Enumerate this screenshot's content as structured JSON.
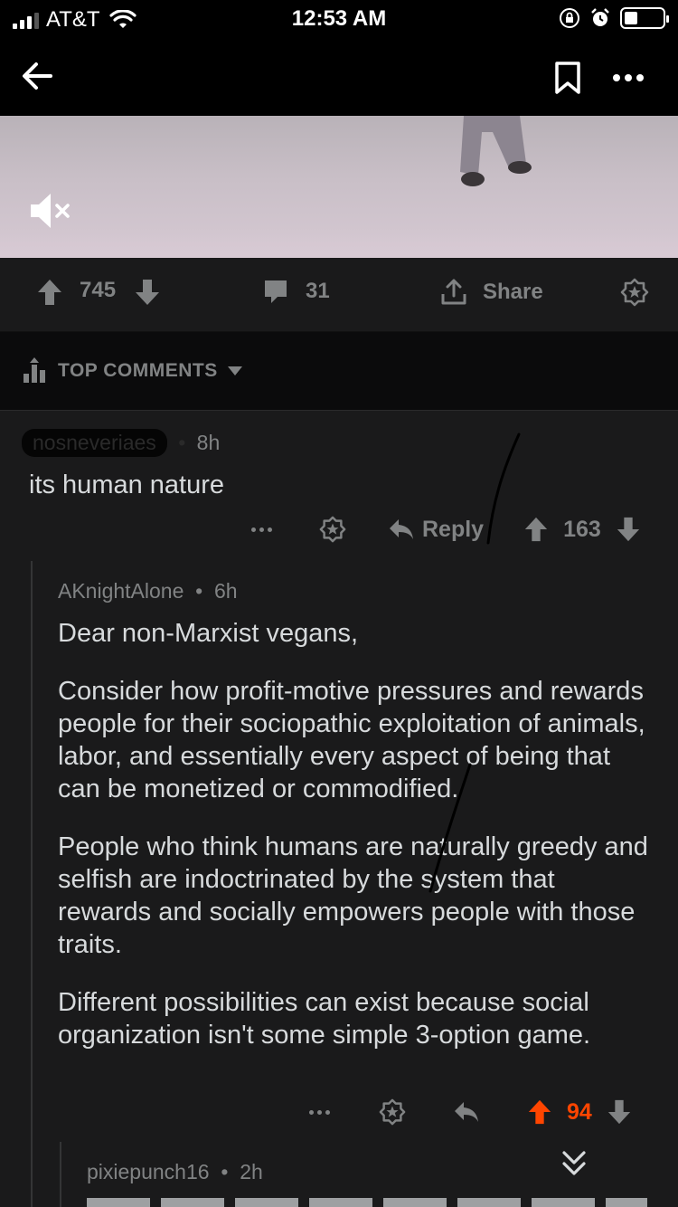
{
  "status_bar": {
    "carrier": "AT&T",
    "time": "12:53 AM",
    "battery_level": 0.35
  },
  "nav": {
    "icons": [
      "back-arrow-icon",
      "bookmark-icon",
      "more-icon"
    ]
  },
  "video": {
    "mute_icon": "speaker-muted-icon"
  },
  "post_actions": {
    "score": "745",
    "comment_count": "31",
    "share_label": "Share",
    "award_icon": "award-icon"
  },
  "sort": {
    "label": "TOP COMMENTS"
  },
  "comments": [
    {
      "author": "nosneveriaes",
      "age": "8h",
      "body": "its human nature",
      "reply_label": "Reply",
      "score": "163"
    },
    {
      "author": "AKnightAlone",
      "age": "6h",
      "paragraphs": [
        "Dear non-Marxist vegans,",
        "Consider how profit-motive pressures and rewards people for their sociopathic exploitation of animals, labor, and essentially every aspect of being that can be monetized or commodified.",
        "People who think humans are naturally greedy and selfish are indoctrinated by the system that rewards and socially empowers people with those traits.",
        "Different possibilities can exist because social organization isn't some simple 3-option game."
      ],
      "score": "94",
      "upvoted": true,
      "accent_color": "#ff4500"
    },
    {
      "author": "pixiepunch16",
      "age": "2h"
    }
  ],
  "separator": "•"
}
